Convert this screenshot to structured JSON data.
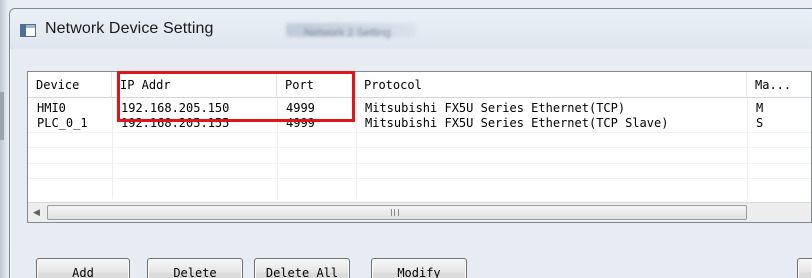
{
  "window": {
    "title": "Network Device Setting",
    "blurred_tab_text": "Network 2 Setting"
  },
  "listview": {
    "columns": [
      "Device",
      "IP Addr",
      "Port",
      "Protocol",
      "Ma..."
    ],
    "rows": [
      {
        "device": "HMI0",
        "ip": "192.168.205.150",
        "port": "4999",
        "protocol": "Mitsubishi FX5U Series Ethernet(TCP)",
        "mode": "M"
      },
      {
        "device": "PLC_0_1",
        "ip": "192.168.205.155",
        "port": "4999",
        "protocol": "Mitsubishi FX5U Series Ethernet(TCP Slave)",
        "mode": "S"
      }
    ],
    "scroll_grip": "III"
  },
  "buttons": {
    "add": "Add",
    "delete": "Delete",
    "delete_all": "Delete All",
    "modify": "Modify"
  },
  "colors": {
    "highlight": "#e0141b"
  },
  "icons": {
    "app": "window-app-icon",
    "scroll_left": "arrow-left-icon"
  }
}
